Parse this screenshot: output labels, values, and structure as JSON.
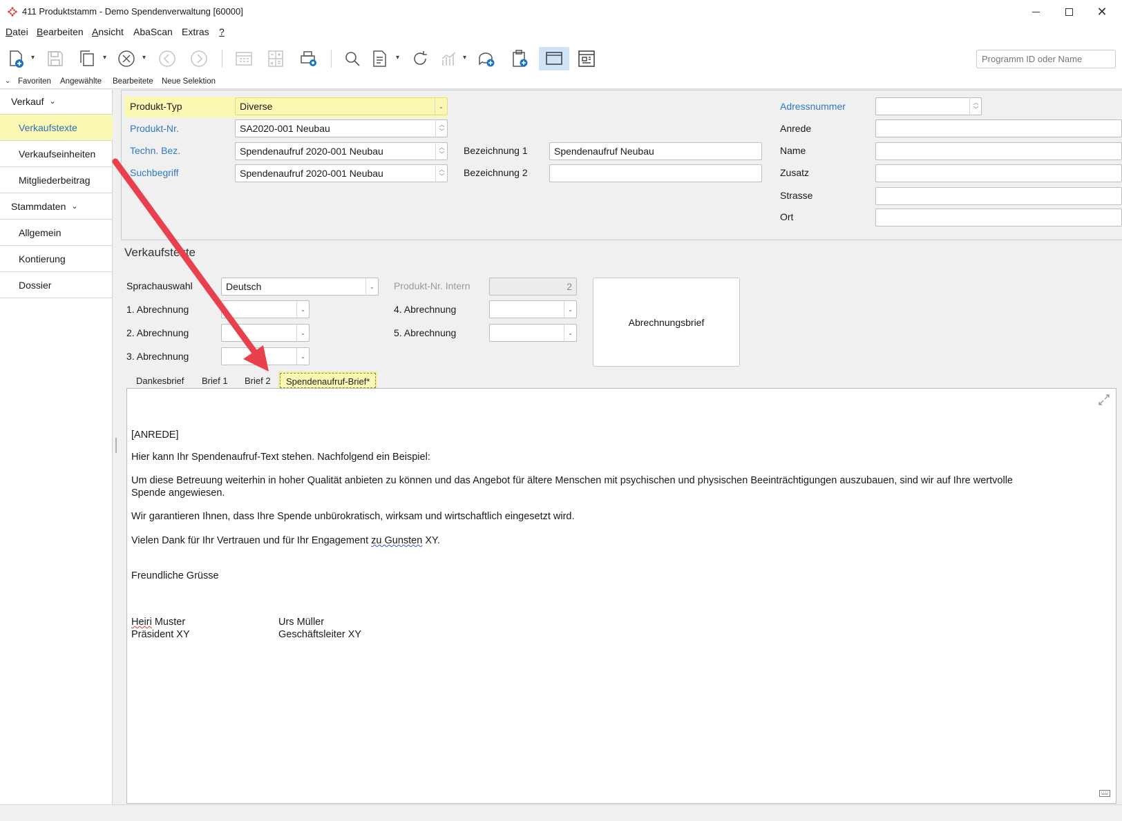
{
  "window": {
    "title": "411 Produktstamm - Demo Spendenverwaltung [60000]"
  },
  "menu": {
    "items": [
      {
        "first": "D",
        "rest": "atei"
      },
      {
        "first": "B",
        "rest": "earbeiten"
      },
      {
        "first": "A",
        "rest": "nsicht"
      },
      {
        "first": "",
        "rest": "AbaScan"
      },
      {
        "first": "",
        "rest": "Extras"
      },
      {
        "first": "?",
        "rest": ""
      }
    ]
  },
  "toolbar": {
    "search_placeholder": "Programm ID oder Name",
    "icons": [
      "new-document-icon",
      "save-icon",
      "copy-icon",
      "cancel-icon",
      "back-icon",
      "forward-icon",
      "grid-icon",
      "calculator-icon",
      "print-settings-icon",
      "search-icon",
      "export-icon",
      "refresh-icon",
      "chart-icon",
      "comment-icon",
      "clipboard-add-icon",
      "screen-icon",
      "layout-icon"
    ]
  },
  "favorites": {
    "items": [
      "Favoriten",
      "Angewählte",
      "Bearbeitete",
      "Neue Selektion"
    ]
  },
  "sidebar": {
    "items": [
      {
        "label": "Verkauf",
        "type": "group"
      },
      {
        "label": "Verkaufstexte",
        "type": "sub",
        "active": true
      },
      {
        "label": "Verkaufseinheiten",
        "type": "sub"
      },
      {
        "label": "Mitgliederbeitrag",
        "type": "sub"
      },
      {
        "label": "Stammdaten",
        "type": "group"
      },
      {
        "label": "Allgemein",
        "type": "sub"
      },
      {
        "label": "Kontierung",
        "type": "sub"
      },
      {
        "label": "Dossier",
        "type": "sub"
      }
    ]
  },
  "header": {
    "produkt_typ_label": "Produkt-Typ",
    "produkt_typ_value": "Diverse",
    "produkt_nr_label": "Produkt-Nr.",
    "produkt_nr_value": "SA2020-001 Neubau",
    "techn_bez_label": "Techn. Bez.",
    "techn_bez_value": "Spendenaufruf 2020-001 Neubau",
    "suchbegriff_label": "Suchbegriff",
    "suchbegriff_value": "Spendenaufruf 2020-001 Neubau",
    "bezeichnung1_label": "Bezeichnung 1",
    "bezeichnung1_value": "Spendenaufruf Neubau",
    "bezeichnung2_label": "Bezeichnung 2",
    "bezeichnung2_value": "",
    "adressnummer_label": "Adressnummer",
    "anrede_label": "Anrede",
    "name_label": "Name",
    "zusatz_label": "Zusatz",
    "strasse_label": "Strasse",
    "ort_label": "Ort"
  },
  "section": {
    "title": "Verkaufstexte",
    "sprachauswahl_label": "Sprachauswahl",
    "sprachauswahl_value": "Deutsch",
    "produkt_nr_intern_label": "Produkt-Nr. Intern",
    "produkt_nr_intern_value": "2",
    "abrechnung1_label": "1. Abrechnung",
    "abrechnung2_label": "2. Abrechnung",
    "abrechnung3_label": "3. Abrechnung",
    "abrechnung4_label": "4. Abrechnung",
    "abrechnung5_label": "5. Abrechnung",
    "letter_button": "Abrechnungsbrief"
  },
  "tabs": [
    "Dankesbrief",
    "Brief 1",
    "Brief 2",
    "Spendenaufruf-Brief*"
  ],
  "editor": {
    "anrede": "[ANREDE]",
    "p1": "Hier kann Ihr Spendenaufruf-Text stehen. Nachfolgend ein Beispiel:",
    "p2_line1": "Um diese Betreuung weiterhin in hoher Qualität anbieten zu können und das Angebot für ältere Menschen mit psychischen und physischen Beeinträchtigungen auszubauen, sind wir auf Ihre wertvolle",
    "p2_line2": "Spende angewiesen.",
    "p3": "Wir garantieren Ihnen, dass Ihre Spende unbürokratisch, wirksam und wirtschaftlich eingesetzt wird.",
    "p4_start": "Vielen Dank für Ihr Vertrauen und für Ihr Engagement ",
    "p4_mark": "zu Gunsten",
    "p4_end": " XY.",
    "closing": "Freundliche Grüsse",
    "sig1_name_mark": "Heiri",
    "sig1_name_rest": " Muster",
    "sig1_title": "Präsident XY",
    "sig2_name": "Urs Müller",
    "sig2_title": "Geschäftsleiter XY"
  }
}
